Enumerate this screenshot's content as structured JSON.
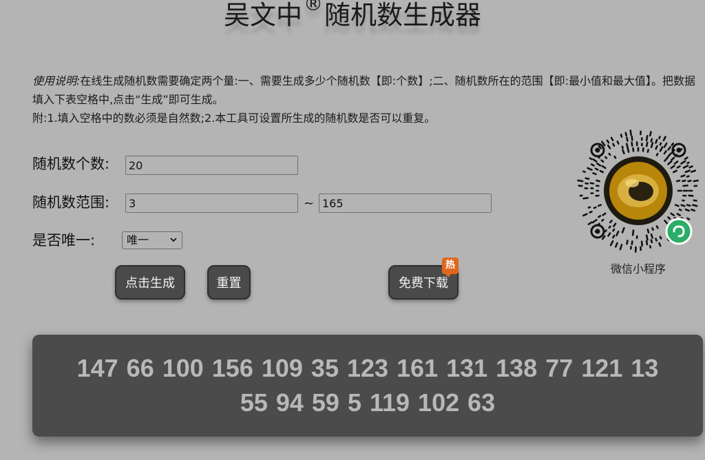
{
  "header": {
    "title_part1": "吴文中",
    "title_reg": "®",
    "title_part2": "随机数生成器"
  },
  "instructions": {
    "lead": "使用说明:",
    "line1": "在线生成随机数需要确定两个量:一、需要生成多少个随机数【即:个数】;二、随机数所在的范围【即:最小值和最大值】。把数据填入下表空格中,点击“生成”即可生成。",
    "line2": "附:1.填入空格中的数必须是自然数;2.本工具可设置所生成的随机数是否可以重复。"
  },
  "form": {
    "count_label": "随机数个数:",
    "count_value": "20",
    "range_label": "随机数范围:",
    "range_min": "3",
    "range_separator": "~",
    "range_max": "165",
    "unique_label": "是否唯一:",
    "unique_selected": "唯一"
  },
  "buttons": {
    "generate": "点击生成",
    "reset": "重置",
    "download": "免费下载",
    "hot_badge": "热"
  },
  "qr": {
    "caption": "微信小程序",
    "icon": "wechat-miniprogram-qr-icon"
  },
  "result": {
    "numbers": "147 66 100 156 109 35 123 161 131 138 77 121 13 55 94 59 5 119 102 63"
  },
  "colors": {
    "background": "#b4b4b4",
    "button": "#4a4a4a",
    "result_bg": "#4b4b4b",
    "result_text": "#b8b8b8",
    "badge": "#e0661e",
    "wechat_green": "#2aae67"
  }
}
